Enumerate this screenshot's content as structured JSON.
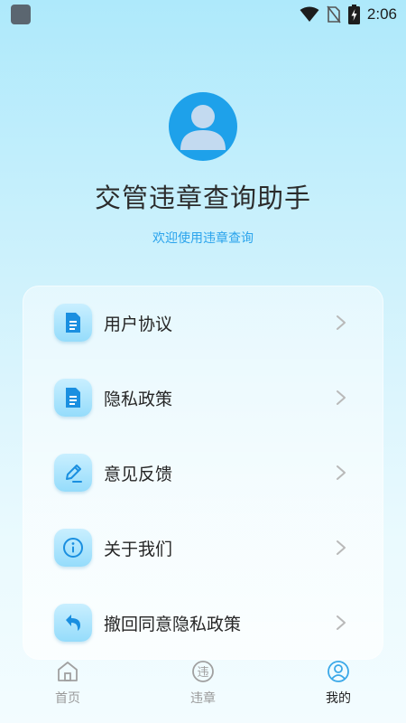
{
  "status_bar": {
    "time": "2:06",
    "icons": [
      "app-indicator-icon",
      "wifi-icon",
      "no-sim-icon",
      "battery-charging-icon"
    ]
  },
  "header": {
    "avatar_icon": "user-avatar-icon",
    "title": "交管违章查询助手",
    "subtitle": "欢迎使用违章查询"
  },
  "menu": {
    "items": [
      {
        "label": "用户协议",
        "icon": "document-icon"
      },
      {
        "label": "隐私政策",
        "icon": "document-icon"
      },
      {
        "label": "意见反馈",
        "icon": "pencil-icon"
      },
      {
        "label": "关于我们",
        "icon": "info-icon"
      },
      {
        "label": "撤回同意隐私政策",
        "icon": "undo-arrow-icon"
      }
    ]
  },
  "tab_bar": {
    "tabs": [
      {
        "label": "首页",
        "icon": "home-icon",
        "active": false
      },
      {
        "label": "违章",
        "icon": "violation-icon",
        "icon_text": "违",
        "active": false
      },
      {
        "label": "我的",
        "icon": "user-circle-icon",
        "active": true
      }
    ]
  },
  "colors": {
    "accent": "#1ea1ea",
    "subtitle": "#2aa3ec",
    "active_tab_icon": "#3aa8e8",
    "inactive_tab": "#9a9a9a"
  }
}
